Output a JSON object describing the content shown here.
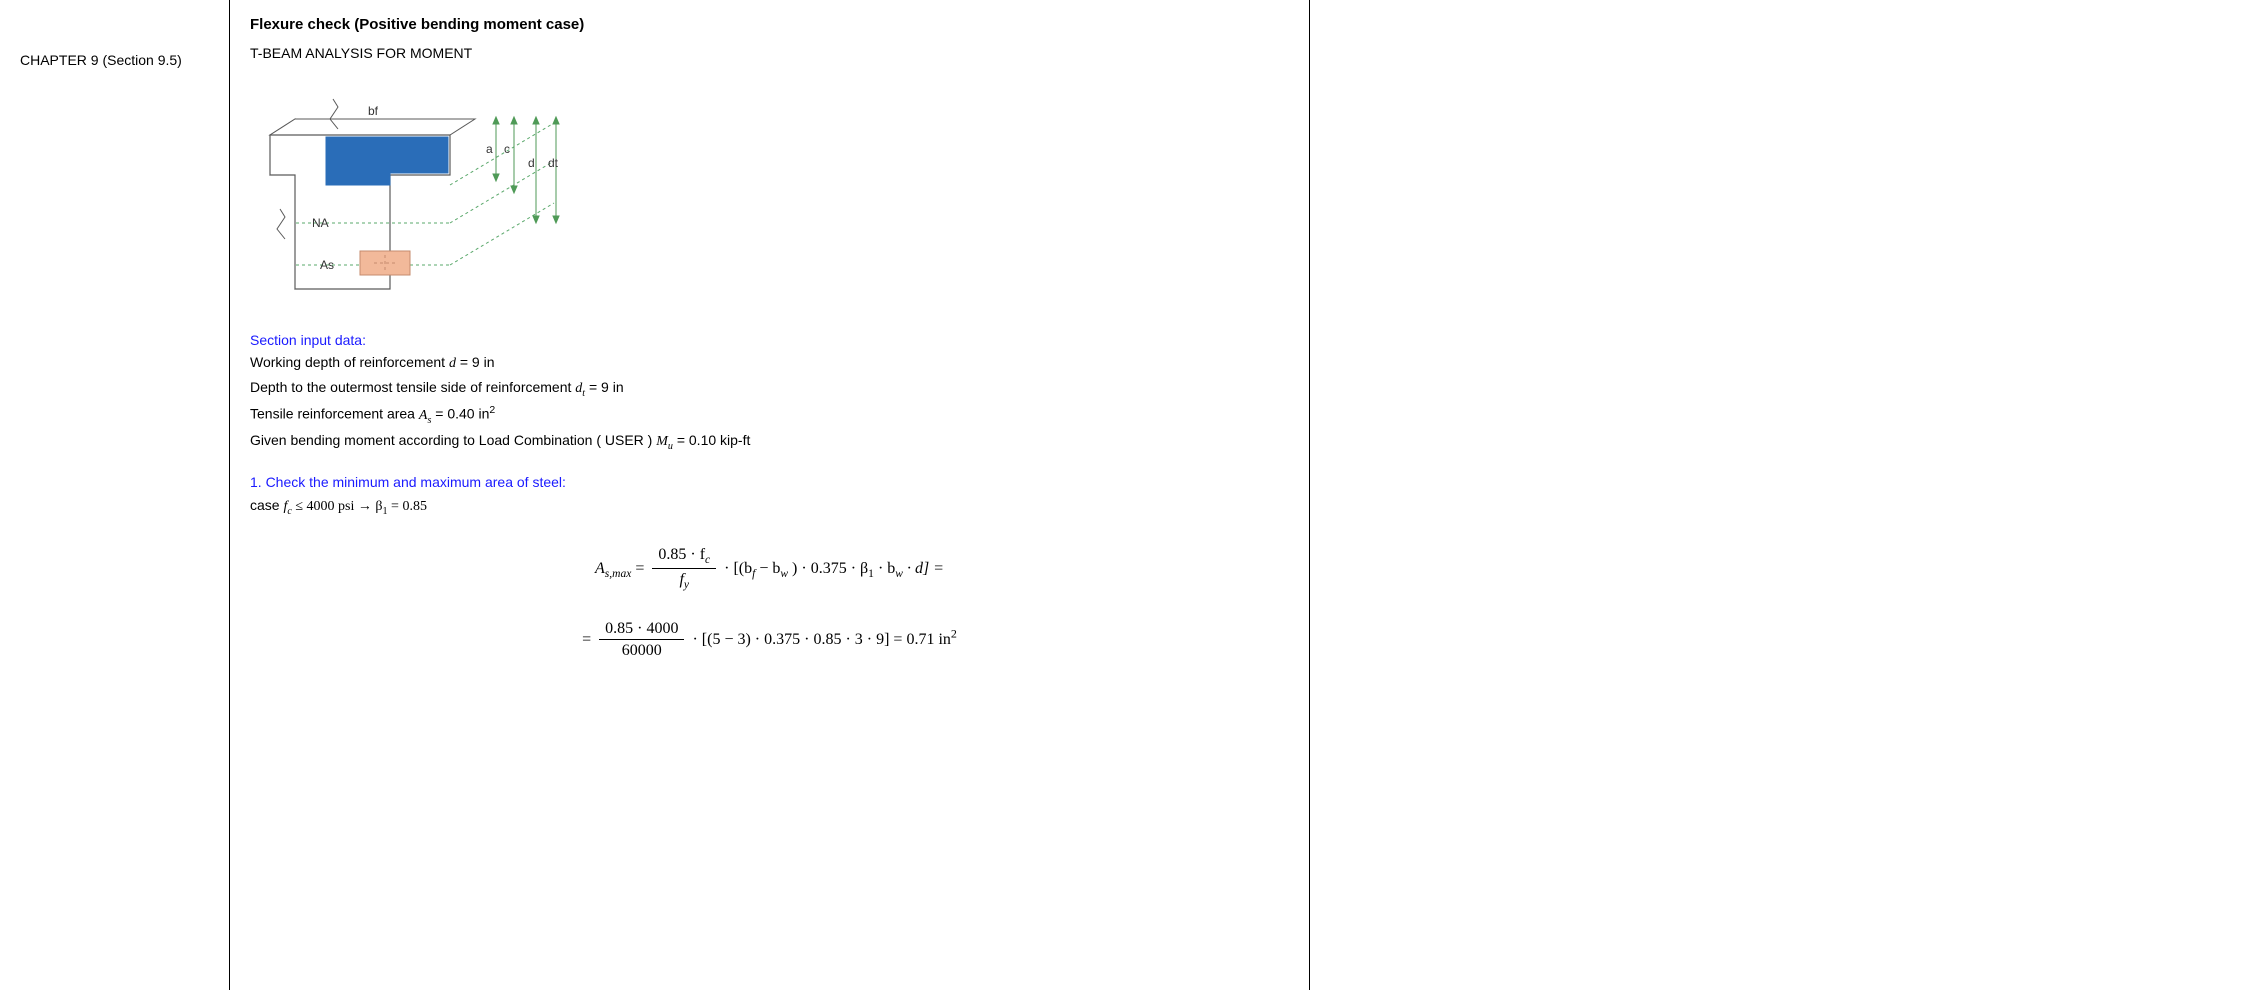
{
  "sidebar": {
    "chapter_ref": "CHAPTER 9 (Section 9.5)"
  },
  "main": {
    "title": "Flexure check (Positive bending moment case)",
    "subtitle": "T-BEAM ANALYSIS FOR MOMENT",
    "diagram_labels": {
      "bf": "bf",
      "a": "a",
      "c": "c",
      "d": "d",
      "dt": "dt",
      "NA": "NA",
      "As": "As"
    },
    "section_input_heading": "Section input data:",
    "inputs": {
      "d_label_pre": "Working depth of reinforcement ",
      "d_value": " = 9  in",
      "dt_label_pre": "Depth to the outermost tensile side of reinforcement ",
      "dt_value": " = 9  in",
      "As_label_pre": "Tensile reinforcement area ",
      "As_value": " = 0.40  in",
      "Mu_label_pre": "Given bending moment according to Load Combination ( USER ) ",
      "Mu_value": " = 0.10  kip-ft"
    },
    "step1_heading": "1. Check the minimum and maximum area of steel:",
    "step1_case_pre": "case ",
    "step1_case_expr": " ≤ 4000 psi → β",
    "step1_case_val": " = 0.85",
    "formula1": {
      "lhs_sub": "s,max",
      "num": "0.85 · f",
      "num_sub": "c",
      "den": "f",
      "den_sub": "y",
      "bracket": " · [(b",
      "bracket2": " − b",
      "bracket3": ") · 0.375 · β",
      "bracket4": " · b",
      "bracket5": " · d] ="
    },
    "formula2": {
      "pre": "= ",
      "num": "0.85 · 4000",
      "den": "60000",
      "tail": " · [(5 − 3) · 0.375 · 0.85 · 3 · 9] = 0.71 in"
    }
  }
}
